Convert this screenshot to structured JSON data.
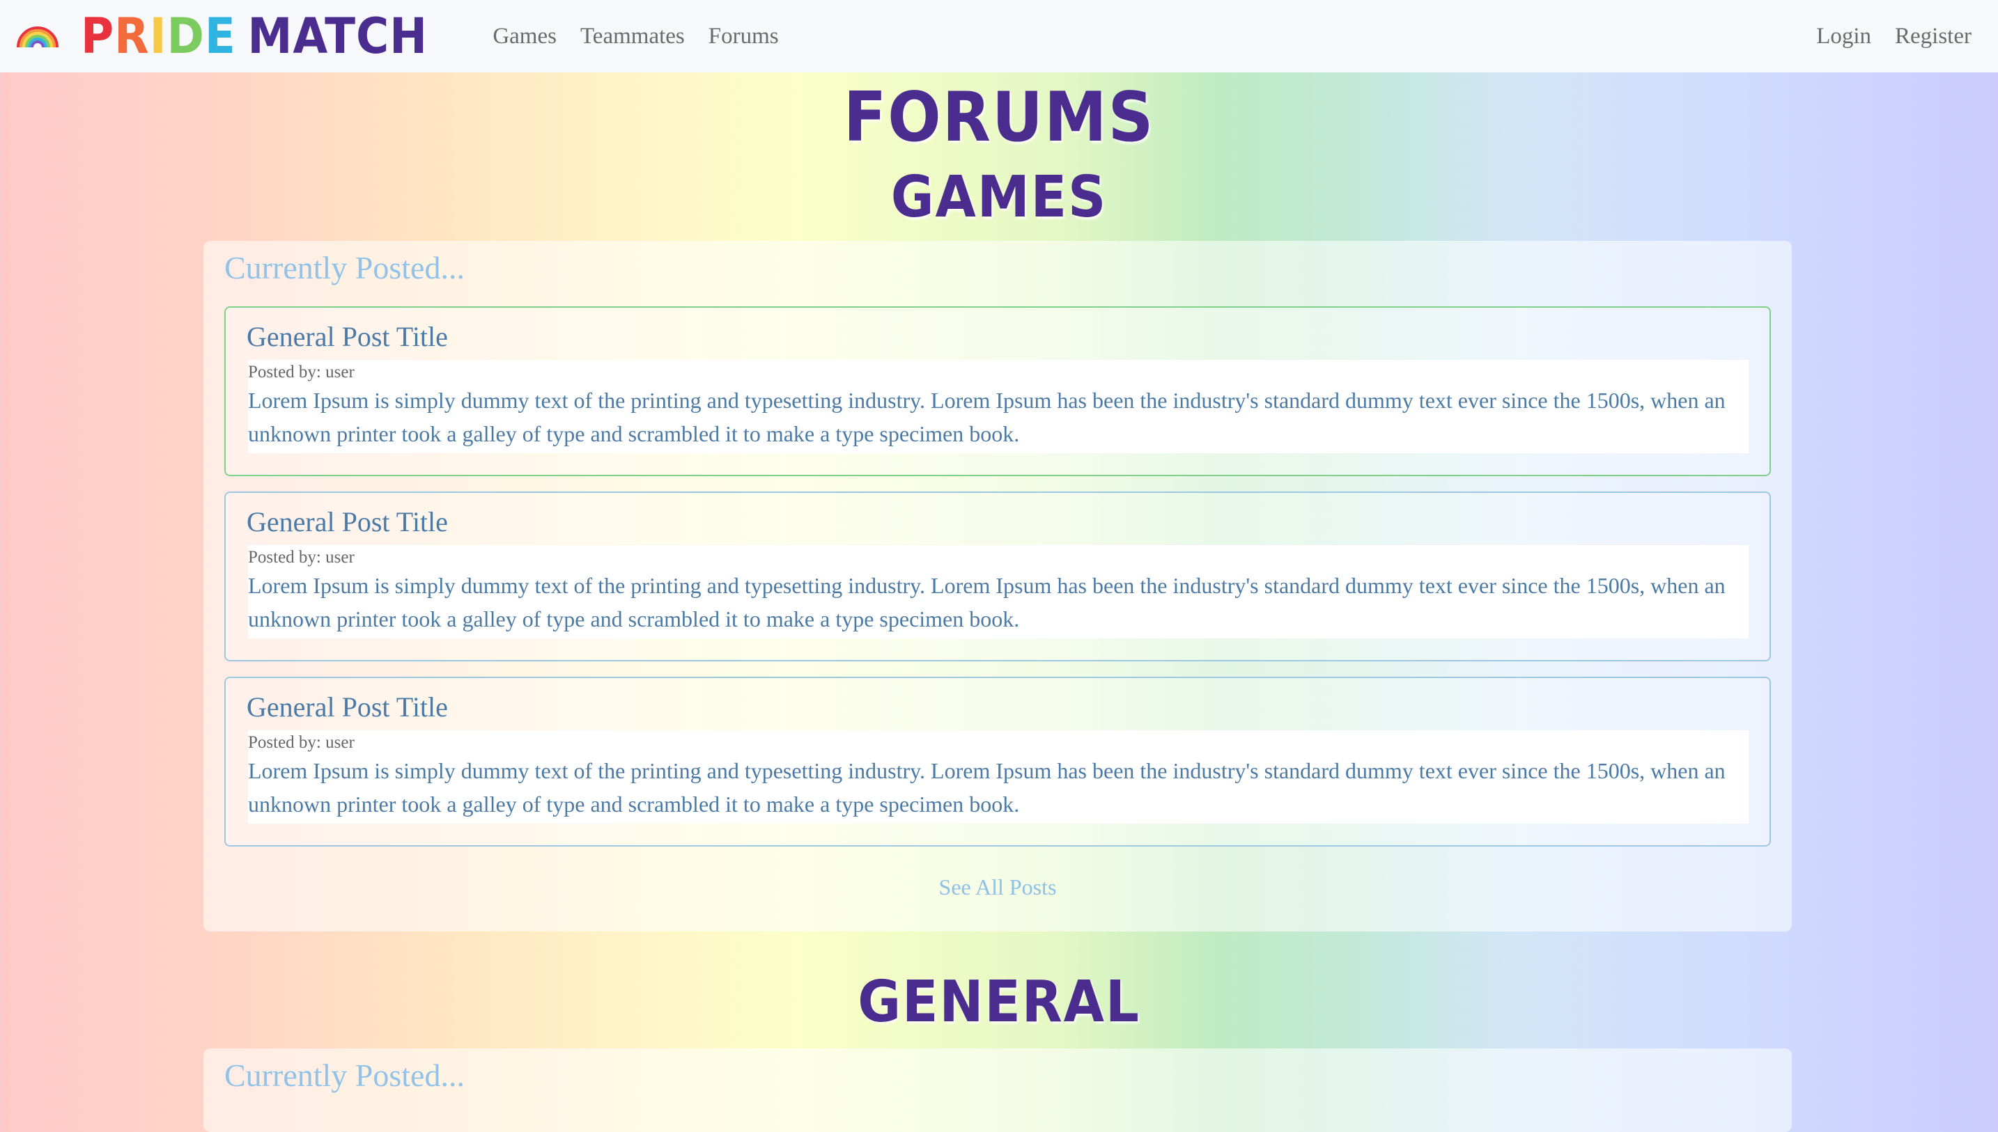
{
  "nav": {
    "brand_letters": [
      "P",
      "R",
      "I",
      "D",
      "E",
      "MATCH"
    ],
    "links": [
      "Games",
      "Teammates",
      "Forums"
    ],
    "auth": [
      "Login",
      "Register"
    ]
  },
  "page_title": "FORUMS",
  "sections": [
    {
      "title": "GAMES",
      "panel_heading": "Currently Posted...",
      "posts": [
        {
          "title": "General Post Title",
          "author": "Posted by: user",
          "text": "Lorem Ipsum is simply dummy text of the printing and typesetting industry. Lorem Ipsum has been the industry's standard dummy text ever since the 1500s, when an unknown printer took a galley of type and scrambled it to make a type specimen book."
        },
        {
          "title": "General Post Title",
          "author": "Posted by: user",
          "text": "Lorem Ipsum is simply dummy text of the printing and typesetting industry. Lorem Ipsum has been the industry's standard dummy text ever since the 1500s, when an unknown printer took a galley of type and scrambled it to make a type specimen book."
        },
        {
          "title": "General Post Title",
          "author": "Posted by: user",
          "text": "Lorem Ipsum is simply dummy text of the printing and typesetting industry. Lorem Ipsum has been the industry's standard dummy text ever since the 1500s, when an unknown printer took a galley of type and scrambled it to make a type specimen book."
        }
      ],
      "see_all": "See All Posts"
    },
    {
      "title": "GENERAL",
      "panel_heading": "Currently Posted..."
    }
  ],
  "colors": {
    "brand_purple": "#4a2d8f",
    "link_blue": "#8ec0e8",
    "active_border": "#7fd08a",
    "card_border": "#9ec7e2"
  },
  "icons": {
    "logo": "rainbow-icon"
  }
}
